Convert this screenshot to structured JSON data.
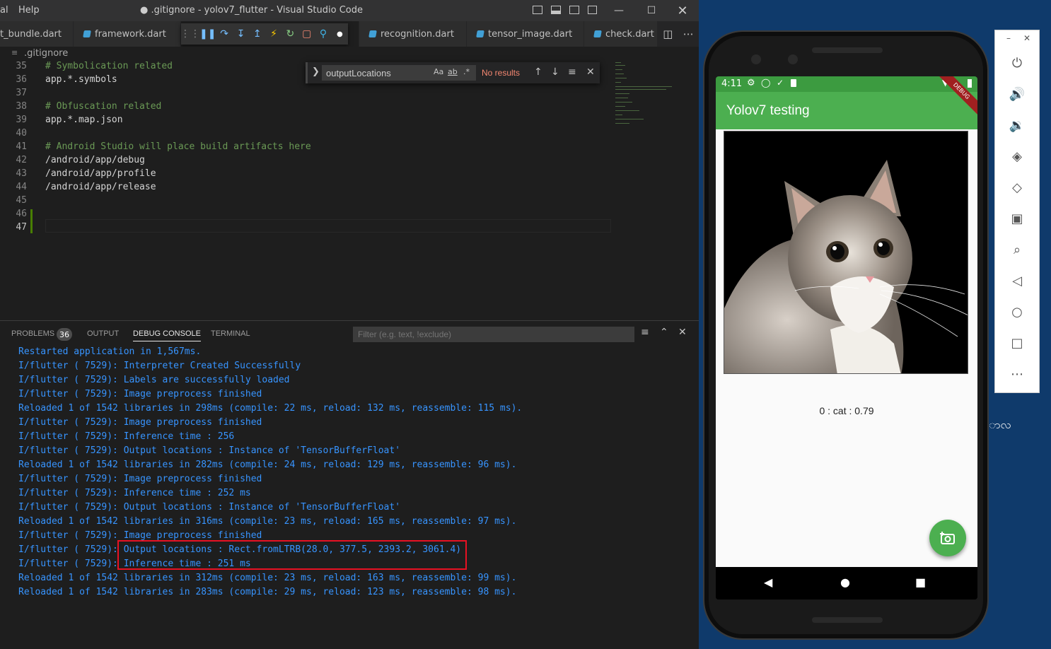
{
  "vscode": {
    "menu": [
      "al",
      "Help"
    ],
    "title": "● .gitignore - yolov7_flutter - Visual Studio Code",
    "tabs": [
      {
        "label": "t_bundle.dart"
      },
      {
        "label": "framework.dart"
      },
      {
        "label": "recognition.dart"
      },
      {
        "label": "tensor_image.dart"
      },
      {
        "label": "check.dart"
      }
    ],
    "breadcrumb": ".gitignore",
    "find": {
      "value": "outputLocations",
      "case_label": "Aa",
      "word_label": "ab",
      "regex_label": ".*",
      "status": "No results"
    },
    "code_lines": [
      {
        "n": "35",
        "text": "# Symbolication related",
        "type": "comment"
      },
      {
        "n": "36",
        "text": "app.*.symbols",
        "type": "code"
      },
      {
        "n": "37",
        "text": "",
        "type": "code"
      },
      {
        "n": "38",
        "text": "# Obfuscation related",
        "type": "comment"
      },
      {
        "n": "39",
        "text": "app.*.map.json",
        "type": "code"
      },
      {
        "n": "40",
        "text": "",
        "type": "code"
      },
      {
        "n": "41",
        "text": "# Android Studio will place build artifacts here",
        "type": "comment"
      },
      {
        "n": "42",
        "text": "/android/app/debug",
        "type": "code"
      },
      {
        "n": "43",
        "text": "/android/app/profile",
        "type": "code"
      },
      {
        "n": "44",
        "text": "/android/app/release",
        "type": "code"
      },
      {
        "n": "45",
        "text": "",
        "type": "code"
      },
      {
        "n": "46",
        "text": "",
        "type": "code"
      },
      {
        "n": "47",
        "text": "",
        "type": "code"
      }
    ],
    "panel": {
      "tabs": [
        "PROBLEMS",
        "OUTPUT",
        "DEBUG CONSOLE",
        "TERMINAL"
      ],
      "problems_count": "36",
      "filter_placeholder": "Filter (e.g. text, !exclude)",
      "console": [
        "Restarted application in 1,567ms.",
        "I/flutter ( 7529): Interpreter Created Successfully",
        "I/flutter ( 7529): Labels are successfully loaded",
        "I/flutter ( 7529): Image preprocess finished",
        "Reloaded 1 of 1542 libraries in 298ms (compile: 22 ms, reload: 132 ms, reassemble: 115 ms).",
        "I/flutter ( 7529): Image preprocess finished",
        "I/flutter ( 7529): Inference time : 256",
        "I/flutter ( 7529): Output locations : Instance of 'TensorBufferFloat'",
        "Reloaded 1 of 1542 libraries in 282ms (compile: 24 ms, reload: 129 ms, reassemble: 96 ms).",
        "I/flutter ( 7529): Image preprocess finished",
        "I/flutter ( 7529): Inference time : 252 ms",
        "I/flutter ( 7529): Output locations : Instance of 'TensorBufferFloat'",
        "Reloaded 1 of 1542 libraries in 316ms (compile: 23 ms, reload: 165 ms, reassemble: 97 ms).",
        "I/flutter ( 7529): Image preprocess finished",
        "I/flutter ( 7529): Output locations : Rect.fromLTRB(28.0, 377.5, 2393.2, 3061.4)",
        "I/flutter ( 7529): Inference time : 251 ms",
        "Reloaded 1 of 1542 libraries in 312ms (compile: 23 ms, reload: 163 ms, reassemble: 99 ms).",
        "Reloaded 1 of 1542 libraries in 283ms (compile: 29 ms, reload: 123 ms, reassemble: 98 ms)."
      ]
    }
  },
  "emulator": {
    "time": "4:11",
    "app_title": "Yolov7 testing",
    "debug_banner": "DEBUG",
    "result": "0 : cat : 0.79",
    "side_panel_icons": [
      "power-icon",
      "volume-up-icon",
      "volume-down-icon",
      "rotate-left-icon",
      "rotate-right-icon",
      "camera-icon",
      "zoom-icon",
      "back-icon",
      "home-icon",
      "overview-icon",
      "more-icon"
    ],
    "bg_text": "ာလ"
  },
  "colors": {
    "accent_green": "#4caf50",
    "console_blue": "#3794ff",
    "highlight_red": "#e81123"
  }
}
